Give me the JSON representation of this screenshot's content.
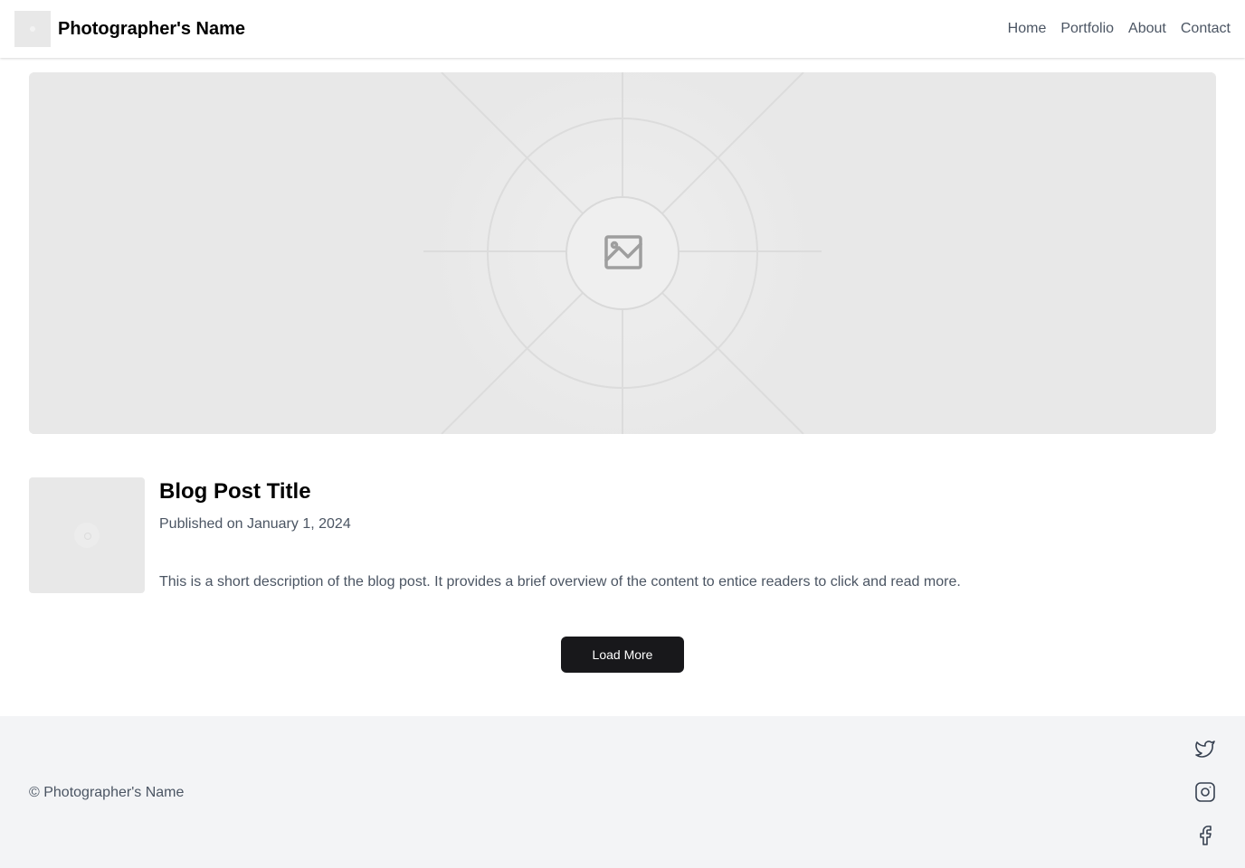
{
  "header": {
    "brand_name": "Photographer's Name",
    "nav": [
      {
        "label": "Home"
      },
      {
        "label": "Portfolio"
      },
      {
        "label": "About"
      },
      {
        "label": "Contact"
      }
    ]
  },
  "hero": {
    "icon": "image-placeholder-icon"
  },
  "post": {
    "title": "Blog Post Title",
    "date": "Published on January 1, 2024",
    "description": "This is a short description of the blog post. It provides a brief overview of the content to entice readers to click and read more."
  },
  "load_more": {
    "label": "Load More"
  },
  "footer": {
    "copyright": "© Photographer's Name",
    "social": [
      {
        "icon": "twitter-icon"
      },
      {
        "icon": "instagram-icon"
      },
      {
        "icon": "facebook-icon"
      }
    ]
  },
  "colors": {
    "primary_button": "#18181b",
    "text_muted": "#4b5563",
    "footer_bg": "#f3f4f6",
    "placeholder_bg": "#e8e8e8"
  }
}
